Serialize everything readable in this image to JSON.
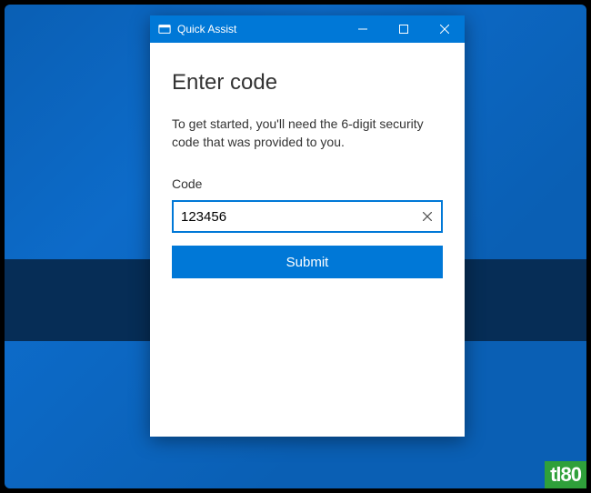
{
  "window": {
    "title": "Quick Assist"
  },
  "content": {
    "heading": "Enter code",
    "description": "To get started, you'll need the 6-digit security code that was provided to you.",
    "code_label": "Code",
    "code_value": "123456",
    "submit_label": "Submit"
  },
  "watermark": "tl80",
  "colors": {
    "accent": "#0078d7"
  }
}
